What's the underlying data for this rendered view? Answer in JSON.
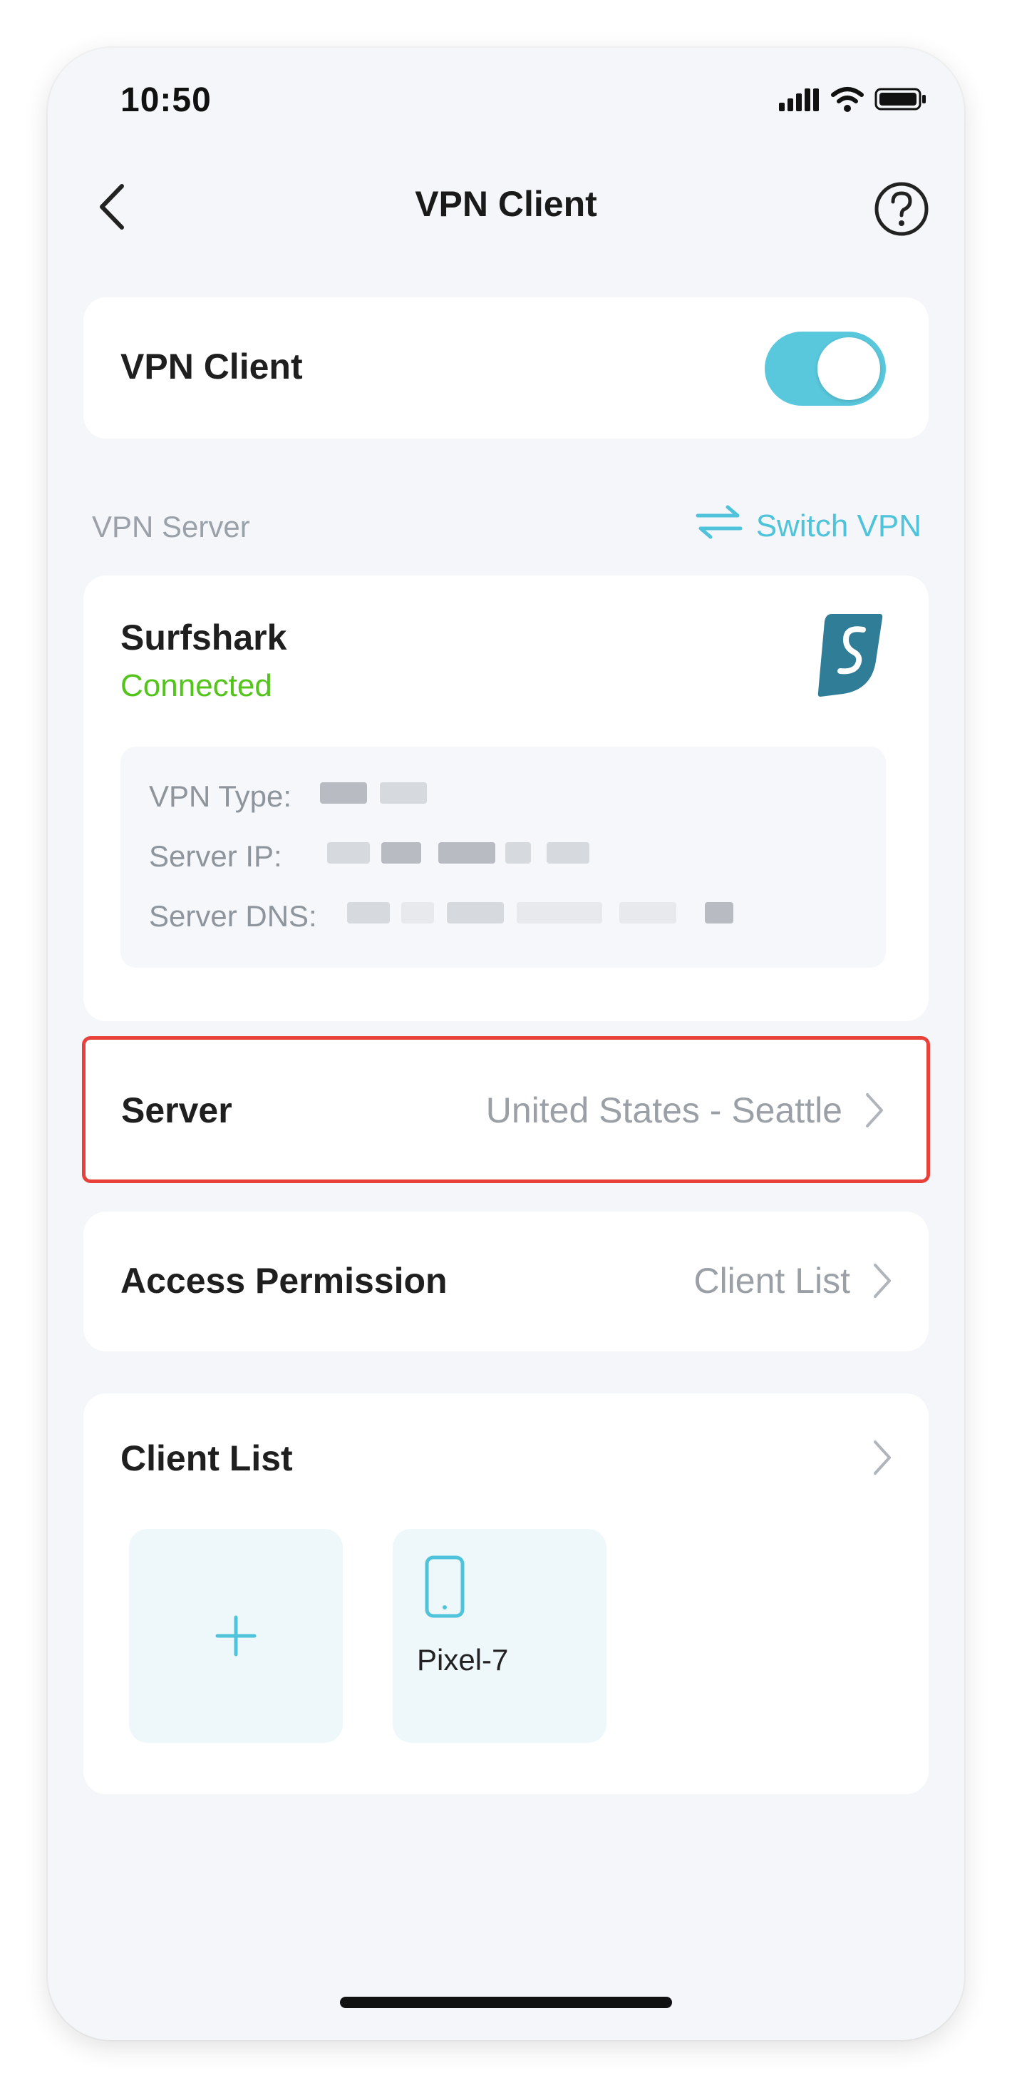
{
  "status_bar": {
    "time": "10:50",
    "signal_icon": "signal-bars-icon",
    "wifi_icon": "wifi-icon",
    "battery_icon": "battery-icon"
  },
  "nav": {
    "title": "VPN Client",
    "back_icon": "chevron-left-icon",
    "help_icon": "help-circle-icon"
  },
  "vpn_client_toggle": {
    "label": "VPN Client",
    "state": "on"
  },
  "vpn_server_section": {
    "label": "VPN Server",
    "switch_label": "Switch VPN",
    "switch_icon": "swap-arrows-icon"
  },
  "server_card": {
    "provider": "Surfshark",
    "status": "Connected",
    "logo_icon": "surfshark-logo-icon",
    "details": [
      {
        "label": "VPN Type:"
      },
      {
        "label": "Server IP:"
      },
      {
        "label": "Server DNS:"
      }
    ]
  },
  "server_row": {
    "label": "Server",
    "value": "United States - Seattle"
  },
  "access_row": {
    "label": "Access Permission",
    "value": "Client List"
  },
  "client_list": {
    "title": "Client List",
    "add_icon": "plus-icon",
    "devices": [
      {
        "name": "Pixel-7",
        "icon": "phone-icon"
      }
    ]
  },
  "colors": {
    "accent": "#5ac8dc",
    "connected": "#52c41a",
    "highlight_border": "#e8413b",
    "page_bg": "#f4f6fa"
  }
}
